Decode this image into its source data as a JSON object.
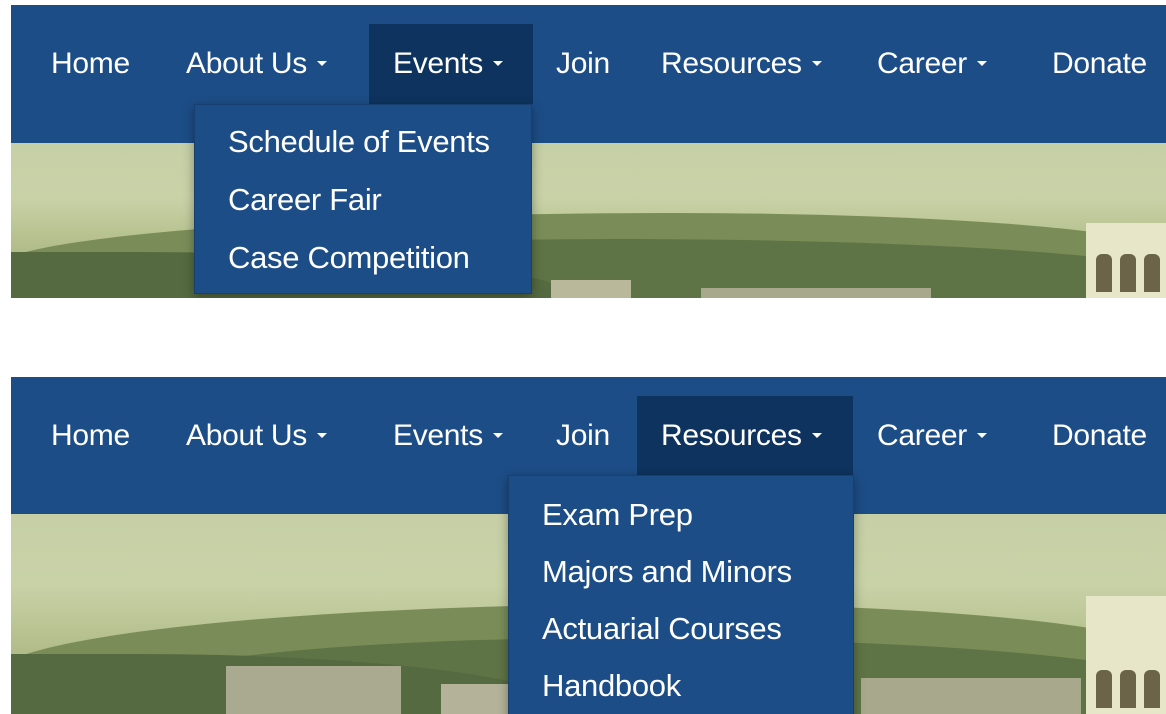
{
  "nav_items": [
    "Home",
    "About Us",
    "Events",
    "Join",
    "Resources",
    "Career",
    "Donate"
  ],
  "panels": [
    {
      "active_item": "Events",
      "dropdown": [
        "Schedule of Events",
        "Career Fair",
        "Case Competition"
      ]
    },
    {
      "active_item": "Resources",
      "dropdown": [
        "Exam Prep",
        "Majors and Minors",
        "Actuarial Courses",
        "Handbook"
      ]
    }
  ],
  "colors": {
    "nav_background": "#1d4d86",
    "active_background": "#0d335e",
    "text": "#ffffff"
  }
}
